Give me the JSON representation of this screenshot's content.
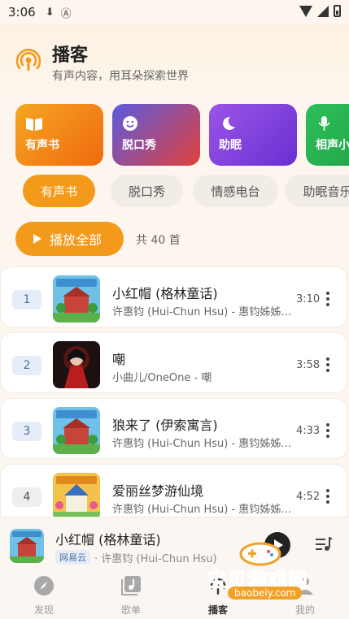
{
  "status_bar": {
    "time": "3:06"
  },
  "header": {
    "title": "播客",
    "subtitle": "有声内容，用耳朵探索世界",
    "icon": "podcast-icon",
    "accent": "#f49a1a"
  },
  "categories": [
    {
      "label": "有声书",
      "icon": "book-icon",
      "color_from": "#f5a623",
      "color_to": "#f06a0f"
    },
    {
      "label": "脱口秀",
      "icon": "smile-icon",
      "color_from": "#5b5be0",
      "color_to": "#e0403a"
    },
    {
      "label": "助眠",
      "icon": "moon-icon",
      "color_from": "#8a4be0",
      "color_to": "#6a2fd0"
    },
    {
      "label": "相声小品",
      "icon": "mic-icon",
      "color_from": "#2fbf5a",
      "color_to": "#1e9e45"
    }
  ],
  "tabs": [
    "有声书",
    "脱口秀",
    "情感电台",
    "助眠音乐"
  ],
  "active_tab": 0,
  "play_all": {
    "label": "播放全部",
    "count_text": "共 40 首"
  },
  "tracks": [
    {
      "index": "1",
      "title": "小红帽 (格林童话)",
      "subtitle": "许惠钧 (Hui-Chun Hsu) - 惠钧姊姊说故事",
      "duration": "3:10"
    },
    {
      "index": "2",
      "title": "嘲",
      "subtitle": "小曲儿/OneOne - 嘲",
      "duration": "3:58"
    },
    {
      "index": "3",
      "title": "狼来了 (伊索寓言)",
      "subtitle": "许惠钧 (Hui-Chun Hsu) - 惠钧姊姊说故事",
      "duration": "4:33"
    },
    {
      "index": "4",
      "title": "爱丽丝梦游仙境",
      "subtitle": "许惠钧 (Hui-Chun Hsu) - 惠钧姊姊说故事",
      "duration": "4:52"
    }
  ],
  "now_playing": {
    "title": "小红帽 (格林童话)",
    "source": "网易云",
    "artist": "· 许惠钧 (Hui-Chun Hsu)"
  },
  "bottom_nav": [
    {
      "label": "发现",
      "icon": "compass-icon"
    },
    {
      "label": "歌单",
      "icon": "music-note-icon"
    },
    {
      "label": "播客",
      "icon": "podcast-icon"
    },
    {
      "label": "我的",
      "icon": "person-icon"
    }
  ],
  "active_nav": 2,
  "watermark": {
    "text": "宝贝游戏网",
    "url": "baobeiy.com"
  }
}
